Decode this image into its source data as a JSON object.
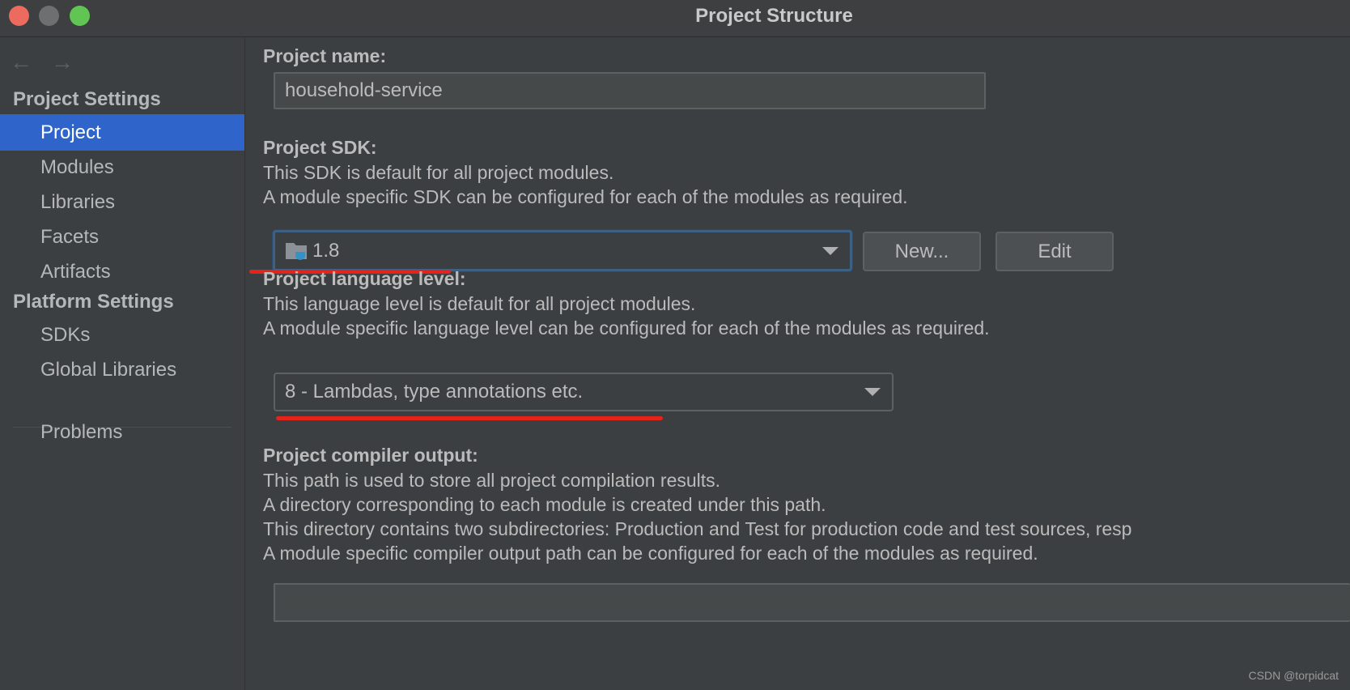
{
  "window": {
    "title": "Project Structure"
  },
  "sidebar": {
    "project_settings_header": "Project Settings",
    "project_items": [
      "Project",
      "Modules",
      "Libraries",
      "Facets",
      "Artifacts"
    ],
    "platform_settings_header": "Platform Settings",
    "platform_items": [
      "SDKs",
      "Global Libraries"
    ],
    "problems": "Problems",
    "selected": "Project"
  },
  "main": {
    "project_name": {
      "label": "Project name:",
      "value": "household-service"
    },
    "sdk": {
      "label": "Project SDK:",
      "desc1": "This SDK is default for all project modules.",
      "desc2": "A module specific SDK can be configured for each of the modules as required.",
      "value": "1.8",
      "new_button": "New...",
      "edit_button": "Edit"
    },
    "language_level": {
      "label": "Project language level:",
      "desc1": "This language level is default for all project modules.",
      "desc2": "A module specific language level can be configured for each of the modules as required.",
      "value": "8 - Lambdas, type annotations etc."
    },
    "compiler_output": {
      "label": "Project compiler output:",
      "desc1": "This path is used to store all project compilation results.",
      "desc2": "A directory corresponding to each module is created under this path.",
      "desc3": "This directory contains two subdirectories: Production and Test for production code and test sources, resp",
      "desc4": "A module specific compiler output path can be configured for each of the modules as required.",
      "value": ""
    }
  },
  "watermark": "CSDN @torpidcat",
  "colors": {
    "selection": "#2f65ca",
    "annotation_underline": "#e4231b",
    "background": "#3c3f41"
  }
}
